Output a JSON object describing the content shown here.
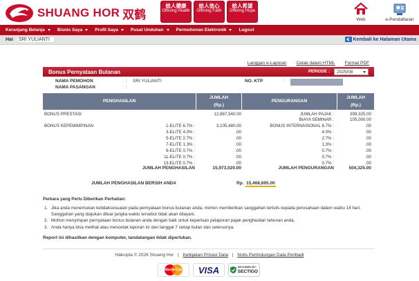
{
  "header": {
    "brand": "SHUANG HOR",
    "brand_cn": "双鹤",
    "slogans": [
      {
        "cn": "给人健康",
        "en": "Offering Health"
      },
      {
        "cn": "给人信心",
        "en": "Offering Faith"
      },
      {
        "cn": "给人希望",
        "en": "Offering Hope"
      }
    ],
    "web_label": "Web",
    "epend_label": "e-Pendaftaran",
    "brand_color": "#c8102e"
  },
  "nav": {
    "items": [
      {
        "label": "Keranjang Belanja",
        "has_caret": true
      },
      {
        "label": "Bisnis Saya",
        "has_caret": true
      },
      {
        "label": "Profil Saya",
        "has_caret": true
      },
      {
        "label": "Pusat Unduhan",
        "has_caret": true
      },
      {
        "label": "Permohonan Elektronik",
        "has_caret": true
      },
      {
        "label": "Logout",
        "has_caret": false
      }
    ],
    "color": "#b60d1e"
  },
  "userbar": {
    "greeting": "Hai",
    "name": "SRI YULIANTI",
    "back_link": "Kembali ke Halaman Utama"
  },
  "links": {
    "report_list": "Langgan e-Laporan",
    "print_html": "Cetak dalam HTML",
    "pdf": "Format PDF"
  },
  "report": {
    "title": "Bonus Pernyataan Bulanan",
    "periode_label": "PERIODE",
    "periode_value": "2025/08",
    "applicant_label": "NAMA PEMOHON",
    "applicant_value": "SRI YULIANTI",
    "spouse_label": "NAMA PASANGAN",
    "spouse_value": "",
    "ktp_label": "NO. KTP",
    "colon": ":",
    "headers": {
      "income": "PENGHASILAN",
      "amount": "JUMLAH",
      "amount_unit": "(Rp.)",
      "deduction": "PENGURANGAN",
      "amount2": "JUMLAH",
      "amount2_unit": "(Rp.)"
    },
    "bonus_prestasi_label": "BONUS PRESTASI",
    "bonus_prestasi_value": "12,867,540.00",
    "bonus_kepemimpinan_label": "BONUS KEPEMIMPINAN",
    "elite_rows": [
      {
        "label": "1-ELITE 6.7% :",
        "value": "3,105,480.00"
      },
      {
        "label": "3-ELITE 4.0% :",
        "value": ".00"
      },
      {
        "label": "5-ELITE 2.7% :",
        "value": ".00"
      },
      {
        "label": "7-ELITE 1.3% :",
        "value": ".00"
      },
      {
        "label": "9-ELITE 0.7% :",
        "value": ".00"
      },
      {
        "label": "11-ELITE 0.7% :",
        "value": ".00"
      },
      {
        "label": "13-ELITE 0.7% :",
        "value": ".00"
      }
    ],
    "deductions": [
      {
        "label": "JUMLAH PAJAK :",
        "value": "399,325.00"
      },
      {
        "label": "BIAYA SEMINAR :",
        "value": "105,000.00"
      },
      {
        "label": "BONUS INTERNASIONAL 6.7% :",
        "value": ".00"
      },
      {
        "label": "4.0% :",
        "value": ".00"
      },
      {
        "label": "2.7% :",
        "value": ".00"
      },
      {
        "label": "1.3% :",
        "value": ".00"
      },
      {
        "label": "0.7% :",
        "value": ".00"
      },
      {
        "label": "0.7% :",
        "value": ".00"
      },
      {
        "label": "0.7% :",
        "value": ".00"
      }
    ],
    "total_income_label": "JUMLAH PENGHASILAN",
    "total_income_value": "15,973,020.00",
    "total_deduction_label": "JUMLAH PENGURANGAN",
    "total_deduction_value": "504,325.00",
    "net_label": "JUMLAH PENGHASILAN BERSIH ANDA",
    "net_currency": "Rp.",
    "net_value": "15,468,695.00"
  },
  "notes": {
    "title": "Perkara yang Perlu Diberikan Perhatian:",
    "items": [
      {
        "n": "1.",
        "text": "Jika anda menemukan ketidaksesuaian pada pernyataan bonus bulanan anda, mohon memberikan sanggahan tertulis kepada perusahaan dalam waktu 14 hari. Sanggahan yang diajukan diluar jangka waktu tersebut tidak akan dilayani."
      },
      {
        "n": "2.",
        "text": "Mohon menyimpan pernyataan bonus bulanan anda dengan baik untuk keperluan pelaporan pajak penghasilan tahunan anda."
      },
      {
        "n": "3.",
        "text": "Anda hanya bisa melihat atau mencetak laporan ini dari tanggal 7 setiap bulan dan seterusnya."
      }
    ],
    "report_note": "Report ini dihasilkan dengan komputer, tandatangan tidak diperlukan."
  },
  "footer": {
    "copyright": "Hakcipta © 2026 Shuang Hor",
    "privacy": "Kebijakan Privasi Data",
    "protection": "Notis Perlindungan Data Peribadi",
    "mastercard": "MasterCard",
    "visa": "VISA",
    "sectigo_top": "SECURED BY",
    "sectigo": "SECTIGO"
  }
}
